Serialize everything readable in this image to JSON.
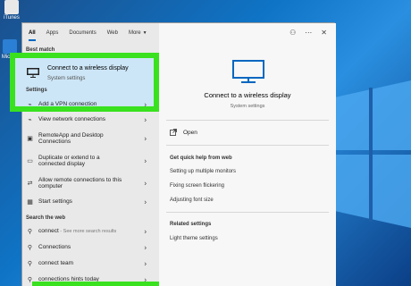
{
  "desktop": {
    "icon1_label": "iTunes",
    "icon2_label": "Mic Ed"
  },
  "tabs": [
    {
      "label": "All",
      "active": true
    },
    {
      "label": "Apps"
    },
    {
      "label": "Documents"
    },
    {
      "label": "Web"
    },
    {
      "label": "More"
    }
  ],
  "top_right": {
    "person_icon": "person-icon",
    "more_icon": "ellipsis-icon",
    "close_icon": "close-icon"
  },
  "best_match": {
    "heading": "Best match",
    "title": "Connect to a wireless display",
    "subtitle": "System settings"
  },
  "settings": {
    "heading": "Settings",
    "items": [
      {
        "label": "Add a VPN connection",
        "icon": "vpn-icon"
      },
      {
        "label": "View network connections",
        "icon": "network-icon"
      },
      {
        "label": "RemoteApp and Desktop Connections",
        "icon": "remote-desktop-icon"
      },
      {
        "label": "Duplicate or extend to a connected display",
        "icon": "display-icon"
      },
      {
        "label": "Allow remote connections to this computer",
        "icon": "remote-icon"
      },
      {
        "label": "Start settings",
        "icon": "start-icon"
      }
    ]
  },
  "web": {
    "heading": "Search the web",
    "items": [
      {
        "label": "connect",
        "hint": " - See more search results",
        "icon": "search-icon"
      },
      {
        "label": "Connections",
        "icon": "search-icon"
      },
      {
        "label": "connect team",
        "icon": "search-icon"
      },
      {
        "label": "connections hints today",
        "icon": "search-icon"
      }
    ]
  },
  "detail": {
    "title": "Connect to a wireless display",
    "subtitle": "System settings",
    "open_label": "Open",
    "help_heading": "Get quick help from web",
    "help_links": [
      "Setting up multiple monitors",
      "Fixing screen flickering",
      "Adjusting font size"
    ],
    "related_heading": "Related settings",
    "related_links": [
      "Light theme settings"
    ]
  },
  "colors": {
    "highlight_border": "#39e11e",
    "selected_bg": "#cde6f7",
    "accent": "#0067c0"
  }
}
